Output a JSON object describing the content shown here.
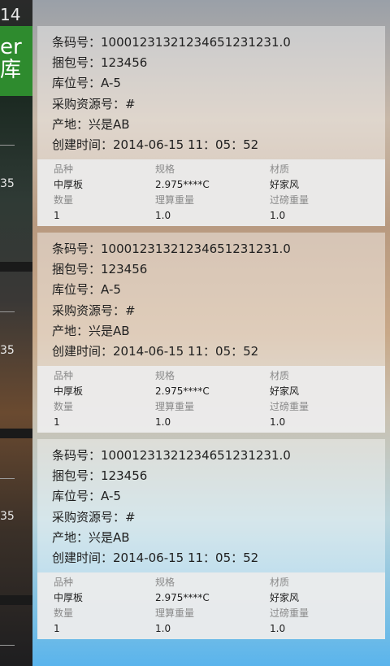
{
  "background": {
    "clock": "14",
    "green_tile": [
      "er",
      "库"
    ],
    "side_numbers": [
      "35",
      "35",
      "35"
    ]
  },
  "labels": {
    "barcode": "条码号：",
    "bundle": "捆包号：",
    "location": "库位号：",
    "purchase": "采购资源号：",
    "origin": "产地：",
    "created": "创建时间：",
    "variety": "品种",
    "spec": "规格",
    "material": "材质",
    "quantity": "数量",
    "theory_weight": "理算重量",
    "scale_weight": "过磅重量"
  },
  "cards": [
    {
      "barcode": "10001231321234651231231.0",
      "bundle": "123456",
      "location": "A-5",
      "purchase": "#",
      "origin": "兴是AB",
      "created": "2014-06-15 11：05：52",
      "variety": "中厚板",
      "spec": "2.975****C",
      "material": "好家风",
      "quantity": "1",
      "theory_weight": "1.0",
      "scale_weight": "1.0"
    },
    {
      "barcode": "10001231321234651231231.0",
      "bundle": "123456",
      "location": "A-5",
      "purchase": "#",
      "origin": "兴是AB",
      "created": "2014-06-15 11：05：52",
      "variety": "中厚板",
      "spec": "2.975****C",
      "material": "好家风",
      "quantity": "1",
      "theory_weight": "1.0",
      "scale_weight": "1.0"
    },
    {
      "barcode": "10001231321234651231231.0",
      "bundle": "123456",
      "location": "A-5",
      "purchase": "#",
      "origin": "兴是AB",
      "created": "2014-06-15 11：05：52",
      "variety": "中厚板",
      "spec": "2.975****C",
      "material": "好家风",
      "quantity": "1",
      "theory_weight": "1.0",
      "scale_weight": "1.0"
    }
  ]
}
